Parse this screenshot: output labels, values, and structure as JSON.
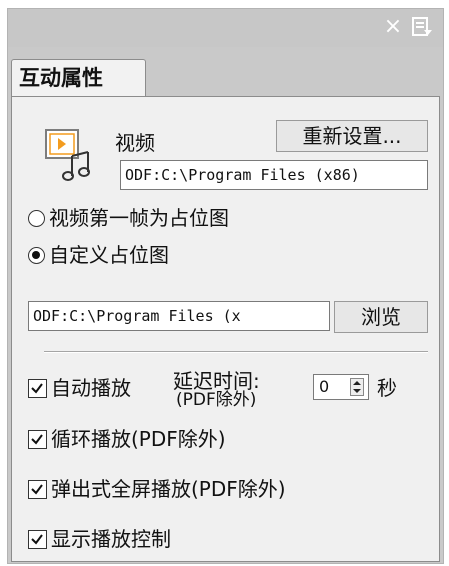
{
  "panel": {
    "tab_label": "互动属性",
    "close_glyph": "×"
  },
  "video": {
    "label": "视频",
    "reset_button": "重新设置...",
    "path_value": "ODF:C:\\Program Files (x86)"
  },
  "placeholder": {
    "option_first_frame": "视频第一帧为占位图",
    "option_custom": "自定义占位图",
    "selected": "自定义占位图",
    "path_value": "ODF:C:\\Program Files (x",
    "browse_button": "浏览"
  },
  "playback": {
    "autoplay_label": "自动播放",
    "delay_label": "延迟时间:",
    "delay_note": "(PDF除外)",
    "delay_value": "0",
    "delay_unit": "秒",
    "loop_label": "循环播放(PDF除外)",
    "popup_label": "弹出式全屏播放(PDF除外)",
    "controls_label": "显示播放控制",
    "autoplay_checked": true,
    "loop_checked": true,
    "popup_checked": true,
    "controls_checked": true
  },
  "icons": {
    "close": "close-icon",
    "panel_menu": "panel-menu-icon",
    "video": "video-file-icon",
    "check": "checkmark-icon"
  },
  "colors": {
    "panel_bg": "#c9c9c9",
    "content_bg": "#f0f0f0",
    "video_icon_accent": "#f39c1f"
  }
}
